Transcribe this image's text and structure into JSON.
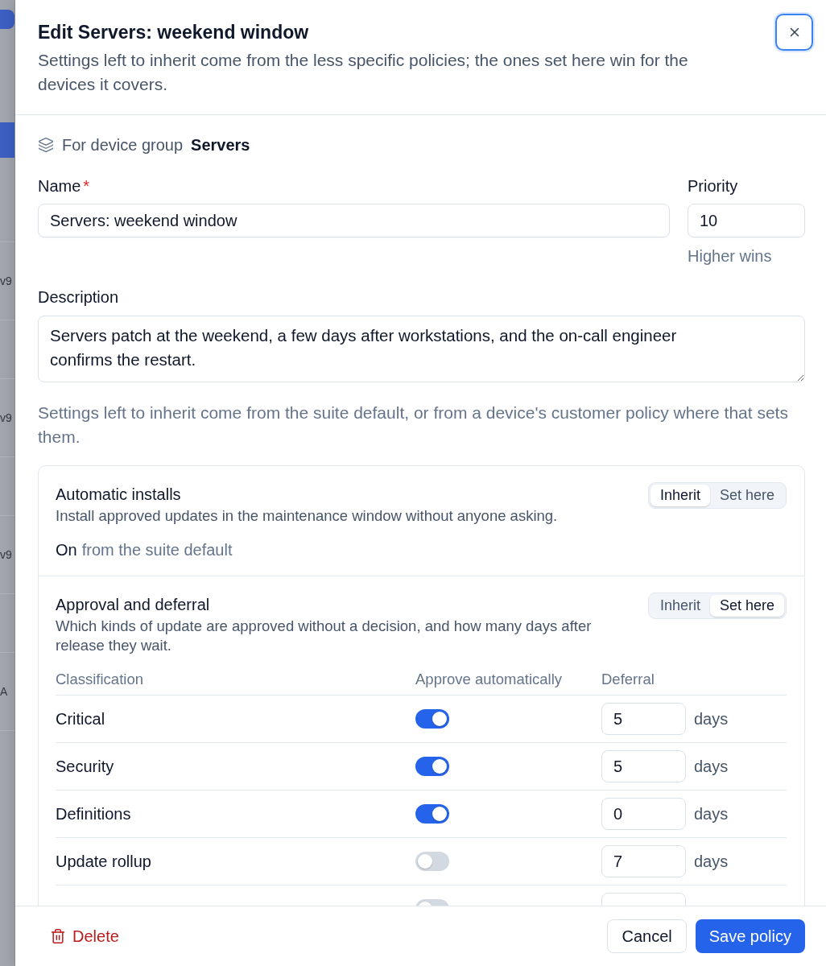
{
  "backdrop": {
    "rows": [
      {
        "selected": true
      },
      {
        "text": "v9",
        "selected": false
      },
      {
        "text": "v9",
        "selected": false
      },
      {
        "text": "v9",
        "selected": false
      },
      {
        "text": "A",
        "selected": false
      }
    ]
  },
  "dialog": {
    "title": "Edit Servers: weekend window",
    "subtitle": "Settings left to inherit come from the less specific policies; the ones set here win for the devices it covers.",
    "close_button": {
      "focused": true
    }
  },
  "scope": {
    "label": "For device group",
    "value": "Servers"
  },
  "form": {
    "name": {
      "label": "Name",
      "required_mark": "*",
      "value": "Servers: weekend window"
    },
    "priority": {
      "label": "Priority",
      "value": "10",
      "hint": "Higher wins"
    },
    "description": {
      "label": "Description",
      "value": "Servers patch at the weekend, a few days after workstations, and the on-call engineer confirms the restart."
    }
  },
  "inherit_note": "Settings left to inherit come from the suite default, or from a device's customer policy where that sets them.",
  "sections": [
    {
      "kind": "summary",
      "title": "Automatic installs",
      "description": "Install approved updates in the maintenance window without anyone asking.",
      "modes": [
        {
          "label": "Inherit",
          "selected": true
        },
        {
          "label": "Set here",
          "selected": false
        }
      ],
      "value": "On",
      "source": "from the suite default"
    },
    {
      "kind": "table",
      "title": "Approval and deferral",
      "description": "Which kinds of update are approved without a decision, and how many days after release they wait.",
      "modes": [
        {
          "label": "Inherit",
          "selected": false
        },
        {
          "label": "Set here",
          "selected": true
        }
      ],
      "columns": [
        "Classification",
        "Approve automatically",
        "Deferral"
      ],
      "rows": [
        {
          "classification": "Critical",
          "auto_approve": true,
          "deferral": "5",
          "unit": "days"
        },
        {
          "classification": "Security",
          "auto_approve": true,
          "deferral": "5",
          "unit": "days"
        },
        {
          "classification": "Definitions",
          "auto_approve": true,
          "deferral": "0",
          "unit": "days"
        },
        {
          "classification": "Update rollup",
          "auto_approve": false,
          "deferral": "7",
          "unit": "days"
        },
        {
          "auto_approve": false
        }
      ]
    }
  ],
  "footer": {
    "delete": "Delete",
    "cancel": "Cancel",
    "save": "Save policy"
  }
}
